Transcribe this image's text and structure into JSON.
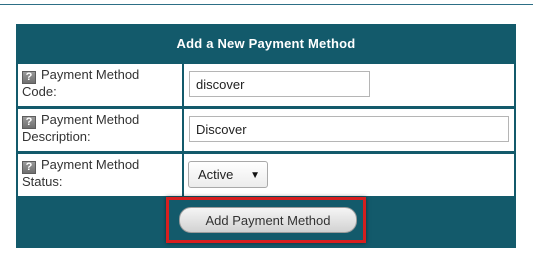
{
  "form": {
    "title": "Add a New Payment Method",
    "help_glyph": "?",
    "fields": [
      {
        "label_line1": "Payment Method",
        "label_line2": "Code:",
        "value": "discover"
      },
      {
        "label_line1": "Payment Method",
        "label_line2": "Description:",
        "value": "Discover"
      },
      {
        "label_line1": "Payment Method",
        "label_line2": "Status:",
        "value": "Active"
      }
    ],
    "submit_label": "Add Payment Method"
  },
  "colors": {
    "panel": "#135a6b",
    "highlight": "#d61f1f"
  },
  "icons": [
    "help-icon",
    "dropdown-arrow-icon"
  ]
}
